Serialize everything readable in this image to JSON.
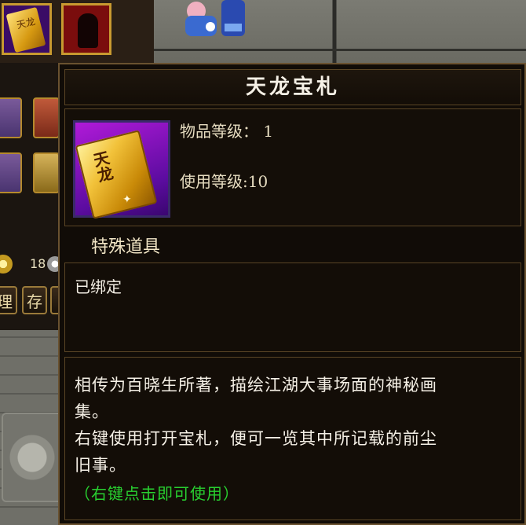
{
  "background": {
    "money": "18",
    "buttons": [
      "理",
      "存",
      "整"
    ]
  },
  "tooltip": {
    "title": "天龙宝札",
    "item_level_label": "物品等级",
    "item_level_value": "1",
    "use_level_label": "使用等级",
    "use_level_value": "10",
    "item_type": "特殊道具",
    "bind_status": "已绑定",
    "description_lines": [
      "相传为百晓生所著，描绘江湖大事场面的神秘画",
      "集。",
      "右键使用打开宝札，便可一览其中所记载的前尘",
      "旧事。"
    ],
    "usage_hint": "（右键点击即可使用）",
    "icon_glyph": "天龙"
  },
  "colors": {
    "hint_green": "#28d030",
    "text_light": "#f5f0e6",
    "border_gold": "#6a5230"
  }
}
